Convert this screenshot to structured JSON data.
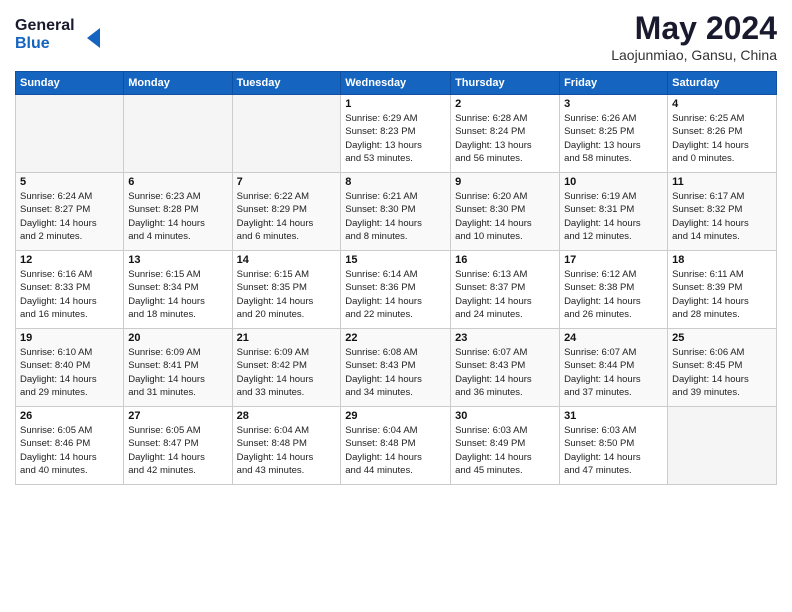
{
  "header": {
    "logo_line1": "General",
    "logo_line2": "Blue",
    "title": "May 2024",
    "subtitle": "Laojunmiao, Gansu, China"
  },
  "weekdays": [
    "Sunday",
    "Monday",
    "Tuesday",
    "Wednesday",
    "Thursday",
    "Friday",
    "Saturday"
  ],
  "weeks": [
    [
      {
        "day": "",
        "info": ""
      },
      {
        "day": "",
        "info": ""
      },
      {
        "day": "",
        "info": ""
      },
      {
        "day": "1",
        "info": "Sunrise: 6:29 AM\nSunset: 8:23 PM\nDaylight: 13 hours\nand 53 minutes."
      },
      {
        "day": "2",
        "info": "Sunrise: 6:28 AM\nSunset: 8:24 PM\nDaylight: 13 hours\nand 56 minutes."
      },
      {
        "day": "3",
        "info": "Sunrise: 6:26 AM\nSunset: 8:25 PM\nDaylight: 13 hours\nand 58 minutes."
      },
      {
        "day": "4",
        "info": "Sunrise: 6:25 AM\nSunset: 8:26 PM\nDaylight: 14 hours\nand 0 minutes."
      }
    ],
    [
      {
        "day": "5",
        "info": "Sunrise: 6:24 AM\nSunset: 8:27 PM\nDaylight: 14 hours\nand 2 minutes."
      },
      {
        "day": "6",
        "info": "Sunrise: 6:23 AM\nSunset: 8:28 PM\nDaylight: 14 hours\nand 4 minutes."
      },
      {
        "day": "7",
        "info": "Sunrise: 6:22 AM\nSunset: 8:29 PM\nDaylight: 14 hours\nand 6 minutes."
      },
      {
        "day": "8",
        "info": "Sunrise: 6:21 AM\nSunset: 8:30 PM\nDaylight: 14 hours\nand 8 minutes."
      },
      {
        "day": "9",
        "info": "Sunrise: 6:20 AM\nSunset: 8:30 PM\nDaylight: 14 hours\nand 10 minutes."
      },
      {
        "day": "10",
        "info": "Sunrise: 6:19 AM\nSunset: 8:31 PM\nDaylight: 14 hours\nand 12 minutes."
      },
      {
        "day": "11",
        "info": "Sunrise: 6:17 AM\nSunset: 8:32 PM\nDaylight: 14 hours\nand 14 minutes."
      }
    ],
    [
      {
        "day": "12",
        "info": "Sunrise: 6:16 AM\nSunset: 8:33 PM\nDaylight: 14 hours\nand 16 minutes."
      },
      {
        "day": "13",
        "info": "Sunrise: 6:15 AM\nSunset: 8:34 PM\nDaylight: 14 hours\nand 18 minutes."
      },
      {
        "day": "14",
        "info": "Sunrise: 6:15 AM\nSunset: 8:35 PM\nDaylight: 14 hours\nand 20 minutes."
      },
      {
        "day": "15",
        "info": "Sunrise: 6:14 AM\nSunset: 8:36 PM\nDaylight: 14 hours\nand 22 minutes."
      },
      {
        "day": "16",
        "info": "Sunrise: 6:13 AM\nSunset: 8:37 PM\nDaylight: 14 hours\nand 24 minutes."
      },
      {
        "day": "17",
        "info": "Sunrise: 6:12 AM\nSunset: 8:38 PM\nDaylight: 14 hours\nand 26 minutes."
      },
      {
        "day": "18",
        "info": "Sunrise: 6:11 AM\nSunset: 8:39 PM\nDaylight: 14 hours\nand 28 minutes."
      }
    ],
    [
      {
        "day": "19",
        "info": "Sunrise: 6:10 AM\nSunset: 8:40 PM\nDaylight: 14 hours\nand 29 minutes."
      },
      {
        "day": "20",
        "info": "Sunrise: 6:09 AM\nSunset: 8:41 PM\nDaylight: 14 hours\nand 31 minutes."
      },
      {
        "day": "21",
        "info": "Sunrise: 6:09 AM\nSunset: 8:42 PM\nDaylight: 14 hours\nand 33 minutes."
      },
      {
        "day": "22",
        "info": "Sunrise: 6:08 AM\nSunset: 8:43 PM\nDaylight: 14 hours\nand 34 minutes."
      },
      {
        "day": "23",
        "info": "Sunrise: 6:07 AM\nSunset: 8:43 PM\nDaylight: 14 hours\nand 36 minutes."
      },
      {
        "day": "24",
        "info": "Sunrise: 6:07 AM\nSunset: 8:44 PM\nDaylight: 14 hours\nand 37 minutes."
      },
      {
        "day": "25",
        "info": "Sunrise: 6:06 AM\nSunset: 8:45 PM\nDaylight: 14 hours\nand 39 minutes."
      }
    ],
    [
      {
        "day": "26",
        "info": "Sunrise: 6:05 AM\nSunset: 8:46 PM\nDaylight: 14 hours\nand 40 minutes."
      },
      {
        "day": "27",
        "info": "Sunrise: 6:05 AM\nSunset: 8:47 PM\nDaylight: 14 hours\nand 42 minutes."
      },
      {
        "day": "28",
        "info": "Sunrise: 6:04 AM\nSunset: 8:48 PM\nDaylight: 14 hours\nand 43 minutes."
      },
      {
        "day": "29",
        "info": "Sunrise: 6:04 AM\nSunset: 8:48 PM\nDaylight: 14 hours\nand 44 minutes."
      },
      {
        "day": "30",
        "info": "Sunrise: 6:03 AM\nSunset: 8:49 PM\nDaylight: 14 hours\nand 45 minutes."
      },
      {
        "day": "31",
        "info": "Sunrise: 6:03 AM\nSunset: 8:50 PM\nDaylight: 14 hours\nand 47 minutes."
      },
      {
        "day": "",
        "info": ""
      }
    ]
  ]
}
